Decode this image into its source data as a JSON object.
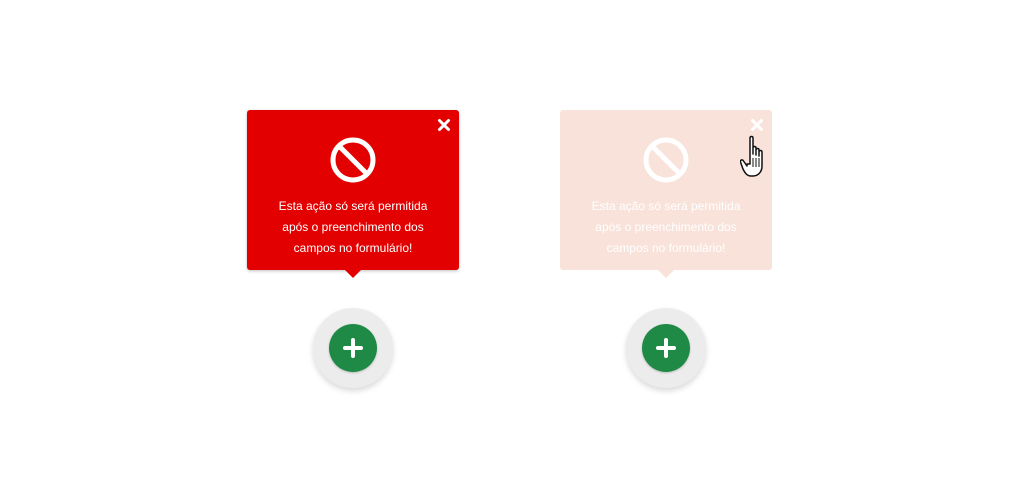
{
  "popups": [
    {
      "state": "active",
      "background": "#e30000",
      "icon": "prohibited-icon",
      "close_icon": "close-icon",
      "message_lines": [
        "Esta ação só será permitida",
        "após o preenchimento dos",
        "campos no formulário!"
      ]
    },
    {
      "state": "faded",
      "background": "#f8e2da",
      "icon": "prohibited-icon",
      "close_icon": "close-icon",
      "message_lines": [
        "Esta ação só será permitida",
        "após o preenchimento dos",
        "campos no formulário!"
      ]
    }
  ],
  "fab": {
    "icon": "plus-icon",
    "color": "#1f8a46",
    "ring_color": "#ececec"
  },
  "cursor": {
    "icon": "hand-pointer-icon"
  }
}
